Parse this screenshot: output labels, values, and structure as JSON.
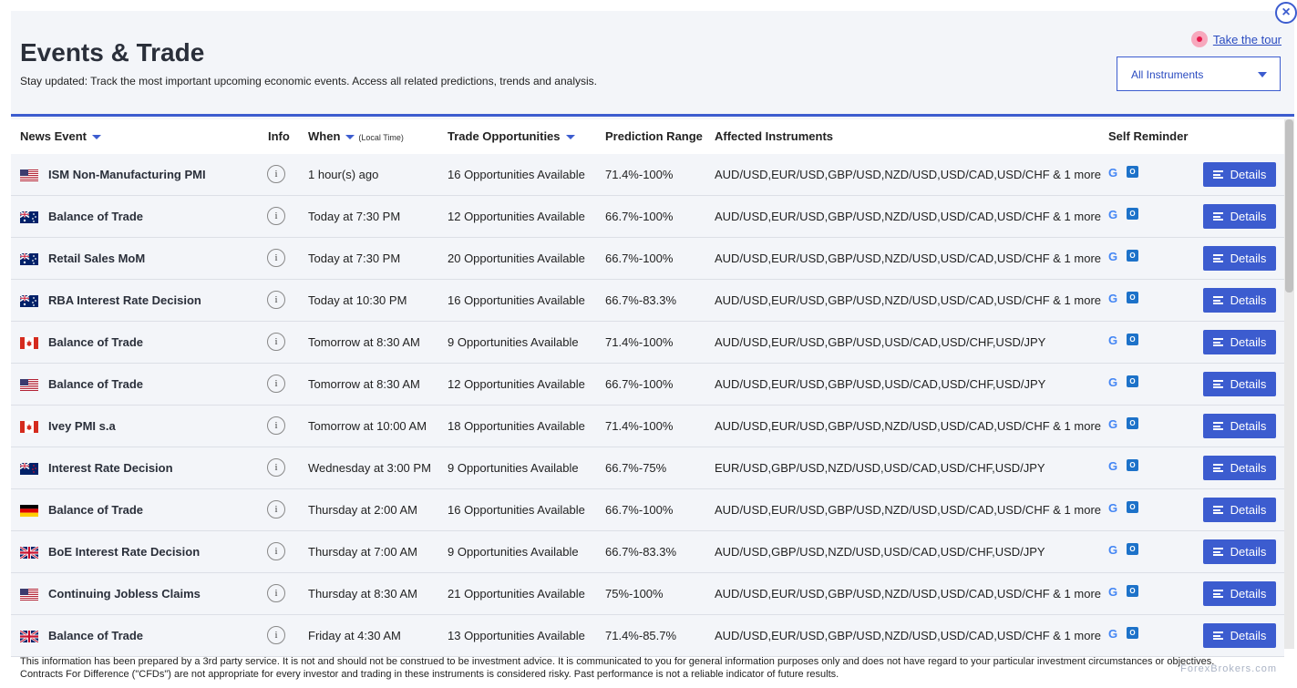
{
  "header": {
    "title": "Events & Trade",
    "subtitle": "Stay updated: Track the most important upcoming economic events. Access all related predictions, trends and analysis.",
    "tour_label": "Take the tour",
    "dropdown_value": "All Instruments"
  },
  "close_label": "×",
  "table": {
    "columns": {
      "event": "News Event",
      "info": "Info",
      "when": "When",
      "when_note": "(Local Time)",
      "opportunities": "Trade Opportunities",
      "prediction": "Prediction Range",
      "instruments": "Affected Instruments",
      "reminder": "Self Reminder"
    },
    "details_label": "Details",
    "info_glyph": "i",
    "rows": [
      {
        "flag": "us",
        "event": "ISM Non-Manufacturing PMI",
        "when": "1 hour(s) ago",
        "opportunities": "16 Opportunities Available",
        "prediction": "71.4%-100%",
        "instruments": "AUD/USD,EUR/USD,GBP/USD,NZD/USD,USD/CAD,USD/CHF & 1 more"
      },
      {
        "flag": "au",
        "event": "Balance of Trade",
        "when": "Today at 7:30 PM",
        "opportunities": "12 Opportunities Available",
        "prediction": "66.7%-100%",
        "instruments": "AUD/USD,EUR/USD,GBP/USD,NZD/USD,USD/CAD,USD/CHF & 1 more"
      },
      {
        "flag": "au",
        "event": "Retail Sales MoM",
        "when": "Today at 7:30 PM",
        "opportunities": "20 Opportunities Available",
        "prediction": "66.7%-100%",
        "instruments": "AUD/USD,EUR/USD,GBP/USD,NZD/USD,USD/CAD,USD/CHF & 1 more"
      },
      {
        "flag": "au",
        "event": "RBA Interest Rate Decision",
        "when": "Today at 10:30 PM",
        "opportunities": "16 Opportunities Available",
        "prediction": "66.7%-83.3%",
        "instruments": "AUD/USD,EUR/USD,GBP/USD,NZD/USD,USD/CAD,USD/CHF & 1 more"
      },
      {
        "flag": "ca",
        "event": "Balance of Trade",
        "when": "Tomorrow at 8:30 AM",
        "opportunities": "9 Opportunities Available",
        "prediction": "71.4%-100%",
        "instruments": "AUD/USD,EUR/USD,GBP/USD,USD/CAD,USD/CHF,USD/JPY"
      },
      {
        "flag": "us",
        "event": "Balance of Trade",
        "when": "Tomorrow at 8:30 AM",
        "opportunities": "12 Opportunities Available",
        "prediction": "66.7%-100%",
        "instruments": "AUD/USD,EUR/USD,GBP/USD,USD/CAD,USD/CHF,USD/JPY"
      },
      {
        "flag": "ca",
        "event": "Ivey PMI s.a",
        "when": "Tomorrow at 10:00 AM",
        "opportunities": "18 Opportunities Available",
        "prediction": "71.4%-100%",
        "instruments": "AUD/USD,EUR/USD,GBP/USD,NZD/USD,USD/CAD,USD/CHF & 1 more"
      },
      {
        "flag": "nz",
        "event": "Interest Rate Decision",
        "when": "Wednesday at 3:00 PM",
        "opportunities": "9 Opportunities Available",
        "prediction": "66.7%-75%",
        "instruments": "EUR/USD,GBP/USD,NZD/USD,USD/CAD,USD/CHF,USD/JPY"
      },
      {
        "flag": "de",
        "event": "Balance of Trade",
        "when": "Thursday at 2:00 AM",
        "opportunities": "16 Opportunities Available",
        "prediction": "66.7%-100%",
        "instruments": "AUD/USD,EUR/USD,GBP/USD,NZD/USD,USD/CAD,USD/CHF & 1 more"
      },
      {
        "flag": "gb",
        "event": "BoE Interest Rate Decision",
        "when": "Thursday at 7:00 AM",
        "opportunities": "9 Opportunities Available",
        "prediction": "66.7%-83.3%",
        "instruments": "AUD/USD,GBP/USD,NZD/USD,USD/CAD,USD/CHF,USD/JPY"
      },
      {
        "flag": "us",
        "event": "Continuing Jobless Claims",
        "when": "Thursday at 8:30 AM",
        "opportunities": "21 Opportunities Available",
        "prediction": "75%-100%",
        "instruments": "AUD/USD,EUR/USD,GBP/USD,NZD/USD,USD/CAD,USD/CHF & 1 more"
      },
      {
        "flag": "gb",
        "event": "Balance of Trade",
        "when": "Friday at 4:30 AM",
        "opportunities": "13 Opportunities Available",
        "prediction": "71.4%-85.7%",
        "instruments": "AUD/USD,EUR/USD,GBP/USD,NZD/USD,USD/CAD,USD/CHF & 1 more"
      }
    ]
  },
  "disclaimer": {
    "line1": "This information has been prepared by a 3rd party service. It is not and should not be construed to be investment advice. It is communicated to you for general information purposes only and does not have regard to your particular investment circumstances or objectives.",
    "line2": "Contracts For Difference (\"CFDs\") are not appropriate for every investor and trading in these instruments is considered risky. Past performance is not a reliable indicator of future results."
  },
  "watermark": "ForexBrokers.com",
  "colors": {
    "accent": "#3c5ccf",
    "background": "#f3f5f9",
    "link": "#2a4bc0"
  }
}
